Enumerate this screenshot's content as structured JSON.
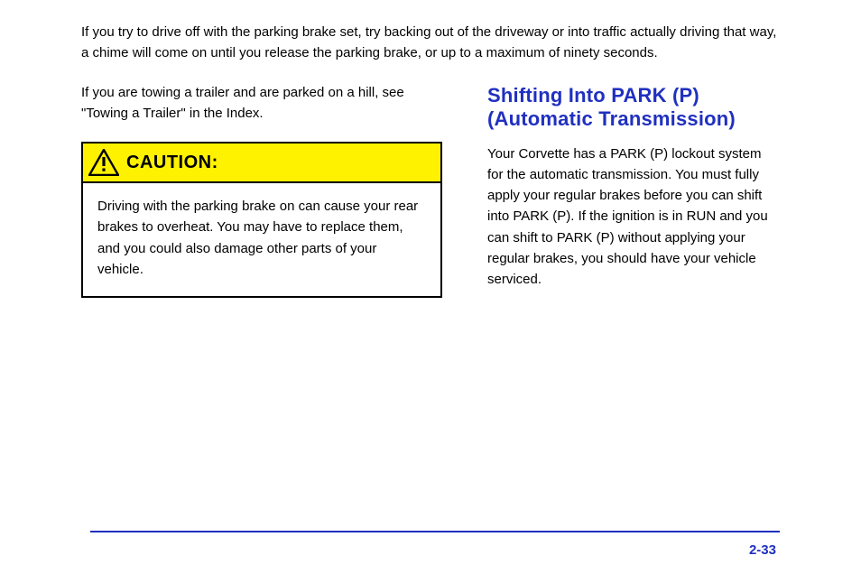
{
  "intro": "If you try to drive off with the parking brake set, try backing out of the driveway or into traffic actually driving that way, a chime will come on until you release the parking brake, or up to a maximum of ninety seconds.",
  "left": {
    "para1": "If you are towing a trailer and are parked on a hill, see \"Towing a Trailer\" in the Index.",
    "caution": {
      "title": "CAUTION:",
      "body": "Driving with the parking brake on can cause your rear brakes to overheat. You may have to replace them, and you could also damage other parts of your vehicle."
    }
  },
  "right": {
    "section_title": "Shifting Into PARK (P) (Automatic Transmission)",
    "para1": "Your Corvette has a PARK (P) lockout system for the automatic transmission. You must fully apply your regular brakes before you can shift into PARK (P). If the ignition is in RUN and you can shift to PARK (P) without applying your regular brakes, you should have your vehicle serviced."
  },
  "page_number": "2-33"
}
